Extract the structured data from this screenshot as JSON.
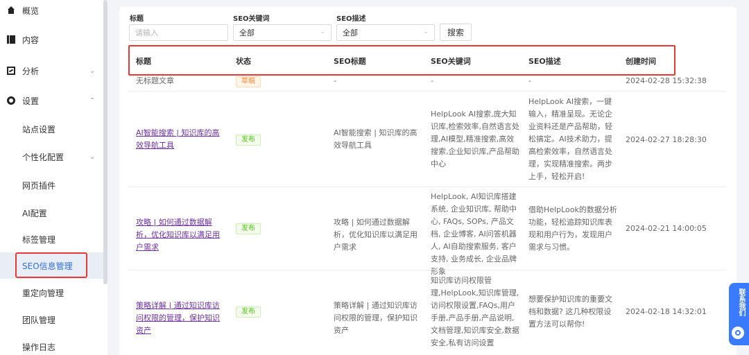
{
  "sidebar": {
    "items": [
      {
        "label": "概览",
        "icon": "home-icon"
      },
      {
        "label": "内容",
        "icon": "content-icon"
      },
      {
        "label": "分析",
        "icon": "chart-icon"
      },
      {
        "label": "设置",
        "icon": "gear-icon"
      },
      {
        "label": "站点设置"
      },
      {
        "label": "个性化配置"
      },
      {
        "label": "网页插件"
      },
      {
        "label": "AI配置"
      },
      {
        "label": "标签管理"
      },
      {
        "label": "SEO信息管理"
      },
      {
        "label": "重定向管理"
      },
      {
        "label": "团队管理"
      },
      {
        "label": "操作日志"
      }
    ],
    "chevron_down": "⌄",
    "chevron_up": "⌃"
  },
  "filters": {
    "title_label": "标题",
    "title_placeholder": "请输入",
    "keyword_label": "SEO关键词",
    "keyword_value": "全部",
    "desc_label": "SEO描述",
    "desc_value": "全部",
    "search_button": "搜索"
  },
  "table": {
    "headers": [
      "标题",
      "状态",
      "SEO标题",
      "SEO关键词",
      "SEO描述",
      "创建时间"
    ],
    "rows": [
      {
        "title": "无标题文章",
        "status": "草稿",
        "seo_title": "-",
        "seo_keywords": "-",
        "seo_desc": "-",
        "created": "2024-02-28 15:32:38"
      },
      {
        "title": "AI智能搜索 | 知识库的高效导航工具",
        "status": "发布",
        "seo_title": "AI智能搜索 | 知识库的高效导航工具",
        "seo_keywords": "HelpLook AI搜索,庞大知识库,检索效率,自然语言处理,AI模型,精准搜索,高效搜索,企业知识库,产品帮助中心",
        "seo_desc": "HelpLook AI搜索，一键输入，精准呈现。无论企业资料还是产品帮助，轻松搞定。AI技术助力，提高检索效率，自然语言处理，实现精准搜索。两步上手，轻松开启!",
        "created": "2024-02-27 18:28:30"
      },
      {
        "title": "攻略 | 如何通过数据解析，优化知识库以满足用户需求",
        "status": "发布",
        "seo_title": "攻略 | 如何通过数据解析，优化知识库以满足用户需求",
        "seo_keywords": "HelpLook, AI知识库搭建系统, 企业知识库, 帮助中心, FAQs, SOPs, 产品文档, 企业博客, AI问答机器人, AI自助搜索服务, 客户支持, 业务成长, 企业品牌形象",
        "seo_desc": "借助HelpLook的数据分析功能，轻松追踪知识库表现和用户行为，发现用户需求与习惯。",
        "created": "2024-02-21 14:00:05"
      },
      {
        "title": "策略详解 | 通过知识库访问权限的管理，保护知识资产",
        "status": "发布",
        "seo_title": "策略详解 | 通过知识库访问权限的管理，保护知识资产",
        "seo_keywords": "知识库访问权限管理,HelpLook,知识库管理,访问权限设置,FAQs,用户手册,产品手册,产品说明,文档管理,知识库安全,数据安全,私有访问设置",
        "seo_desc": "想要保护知识库的重要文档和数据? 这几种权限设置方法可以帮你!",
        "created": "2024-02-18 14:32:01"
      }
    ]
  },
  "widget": {
    "label": "联系我们"
  }
}
